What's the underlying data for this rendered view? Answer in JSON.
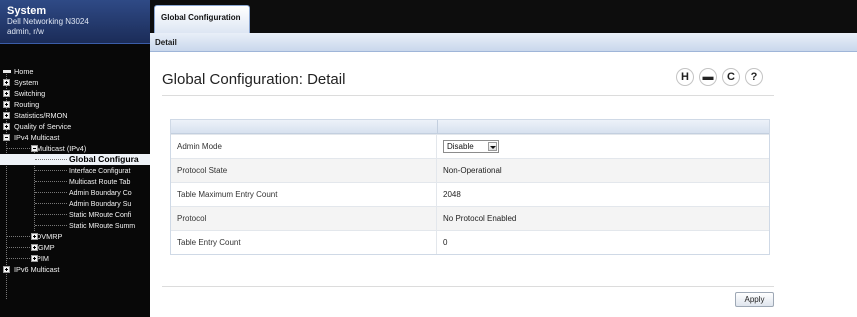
{
  "sidebar": {
    "title": "System",
    "device": "Dell Networking N3024",
    "user": "admin, r/w",
    "tree": {
      "home": "Home",
      "system": "System",
      "switching": "Switching",
      "routing": "Routing",
      "statistics": "Statistics/RMON",
      "qos": "Quality of Service",
      "ipv4_multicast": "IPv4 Multicast",
      "multicast_ipv4": "Multicast (IPv4)",
      "children": [
        "Global Configura",
        "Interface Configurat",
        "Multicast Route Tab",
        "Admin Boundary Co",
        "Admin Boundary Su",
        "Static MRoute Confi",
        "Static MRoute Summ"
      ],
      "dvmrp": "DVMRP",
      "igmp": "IGMP",
      "pim": "PIM",
      "ipv6_multicast": "IPv6 Multicast"
    }
  },
  "tabs": {
    "active": "Global Configuration",
    "sub": "Detail"
  },
  "page": {
    "title": "Global Configuration: Detail"
  },
  "toolbar_icons": [
    "help-icon",
    "print-icon",
    "refresh-icon",
    "question-icon"
  ],
  "toolbar_glyphs": {
    "help": "H",
    "print": "▬",
    "refresh": "C",
    "question": "?"
  },
  "fields": {
    "admin_mode": {
      "label": "Admin Mode",
      "value": "Disable"
    },
    "protocol_state": {
      "label": "Protocol State",
      "value": "Non-Operational"
    },
    "table_max": {
      "label": "Table Maximum Entry Count",
      "value": "2048"
    },
    "protocol": {
      "label": "Protocol",
      "value": "No Protocol Enabled"
    },
    "table_entry": {
      "label": "Table Entry Count",
      "value": "0"
    }
  },
  "apply_label": "Apply",
  "colors": {
    "header_blue": "#2f4a86",
    "selected_row": "#eef2f7",
    "grid_head": "#d7e1ef"
  }
}
